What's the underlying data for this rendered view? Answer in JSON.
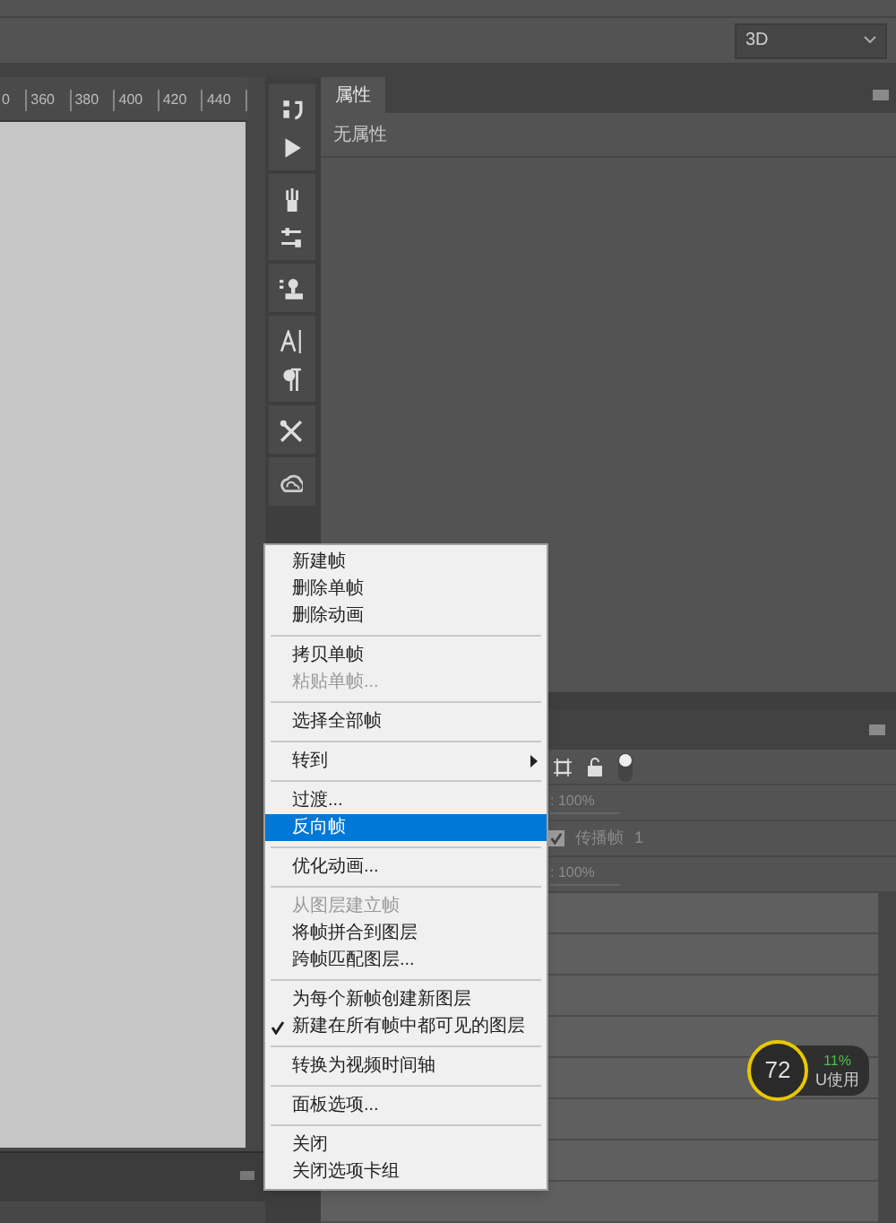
{
  "options_bar": {
    "workspace": "3D"
  },
  "ruler": {
    "labels": [
      "0",
      "360",
      "380",
      "400",
      "420",
      "440"
    ]
  },
  "properties": {
    "tab": "属性",
    "content": "无属性"
  },
  "layers": {
    "opacity": ": 100%",
    "propagate": {
      "label": "传播帧",
      "value": "1",
      "checked": true
    },
    "fill": ": 100%"
  },
  "menu": {
    "items": [
      {
        "kind": "item",
        "label": "新建帧",
        "disabled": false,
        "selected": false,
        "checked": false
      },
      {
        "kind": "item",
        "label": "删除单帧",
        "disabled": false,
        "selected": false,
        "checked": false
      },
      {
        "kind": "item",
        "label": "删除动画",
        "disabled": false,
        "selected": false,
        "checked": false
      },
      {
        "kind": "separator"
      },
      {
        "kind": "item",
        "label": "拷贝单帧",
        "disabled": false,
        "selected": false,
        "checked": false
      },
      {
        "kind": "item",
        "label": "粘贴单帧...",
        "disabled": true,
        "selected": false,
        "checked": false
      },
      {
        "kind": "separator"
      },
      {
        "kind": "item",
        "label": "选择全部帧",
        "disabled": false,
        "selected": false,
        "checked": false
      },
      {
        "kind": "separator"
      },
      {
        "kind": "submenu",
        "label": "转到",
        "disabled": false,
        "selected": false,
        "checked": false
      },
      {
        "kind": "separator"
      },
      {
        "kind": "item",
        "label": "过渡...",
        "disabled": false,
        "selected": false,
        "checked": false
      },
      {
        "kind": "item",
        "label": "反向帧",
        "disabled": false,
        "selected": true,
        "checked": false
      },
      {
        "kind": "separator"
      },
      {
        "kind": "item",
        "label": "优化动画...",
        "disabled": false,
        "selected": false,
        "checked": false
      },
      {
        "kind": "separator"
      },
      {
        "kind": "item",
        "label": "从图层建立帧",
        "disabled": true,
        "selected": false,
        "checked": false
      },
      {
        "kind": "item",
        "label": "将帧拼合到图层",
        "disabled": false,
        "selected": false,
        "checked": false
      },
      {
        "kind": "item",
        "label": "跨帧匹配图层...",
        "disabled": false,
        "selected": false,
        "checked": false
      },
      {
        "kind": "separator"
      },
      {
        "kind": "item",
        "label": "为每个新帧创建新图层",
        "disabled": false,
        "selected": false,
        "checked": false
      },
      {
        "kind": "item",
        "label": "新建在所有帧中都可见的图层",
        "disabled": false,
        "selected": false,
        "checked": true
      },
      {
        "kind": "separator"
      },
      {
        "kind": "item",
        "label": "转换为视频时间轴",
        "disabled": false,
        "selected": false,
        "checked": false
      },
      {
        "kind": "separator"
      },
      {
        "kind": "item",
        "label": "面板选项...",
        "disabled": false,
        "selected": false,
        "checked": false
      },
      {
        "kind": "separator"
      },
      {
        "kind": "item",
        "label": "关闭",
        "disabled": false,
        "selected": false,
        "checked": false
      },
      {
        "kind": "item",
        "label": "关闭选项卡组",
        "disabled": false,
        "selected": false,
        "checked": false
      }
    ]
  },
  "monitor": {
    "score": "72",
    "percent": "11%",
    "label": "U使用"
  }
}
